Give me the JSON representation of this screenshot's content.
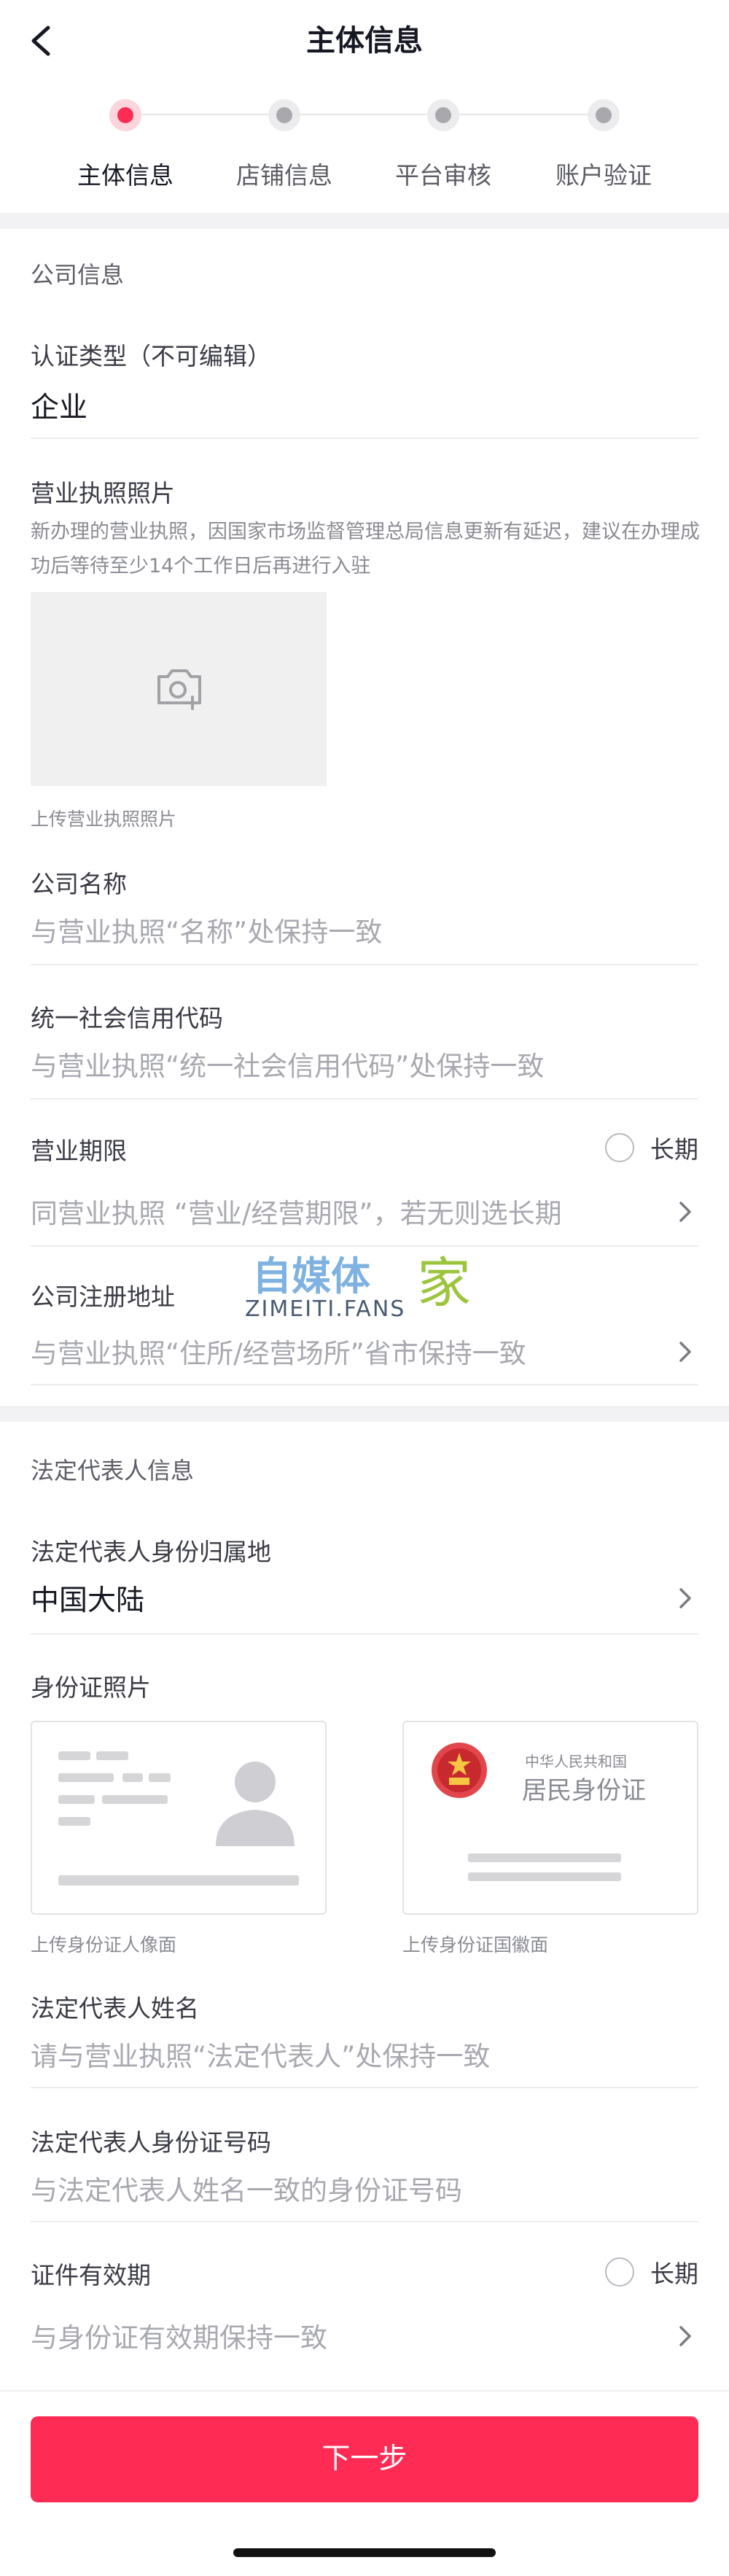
{
  "header": {
    "title": "主体信息"
  },
  "stepper": {
    "steps": [
      {
        "label": "主体信息",
        "active": true
      },
      {
        "label": "店铺信息",
        "active": false
      },
      {
        "label": "平台审核",
        "active": false
      },
      {
        "label": "账户验证",
        "active": false
      }
    ]
  },
  "company": {
    "section_title": "公司信息",
    "cert_type_label": "认证类型（不可编辑）",
    "cert_type_value": "企业",
    "license_label": "营业执照照片",
    "license_hint": "新办理的营业执照，因国家市场监督管理总局信息更新有延迟，建议在办理成功后等待至少14个工作日后再进行入驻",
    "license_caption": "上传营业执照照片",
    "name_label": "公司名称",
    "name_placeholder": "与营业执照“名称”处保持一致",
    "credit_label": "统一社会信用代码",
    "credit_placeholder": "与营业执照“统一社会信用代码”处保持一致",
    "term_label": "营业期限",
    "term_long_label": "长期",
    "term_placeholder": "同营业执照 “营业/经营期限”，若无则选长期",
    "address_label": "公司注册地址",
    "address_placeholder": "与营业执照“住所/经营场所”省市保持一致"
  },
  "legal": {
    "section_title": "法定代表人信息",
    "region_label": "法定代表人身份归属地",
    "region_value": "中国大陆",
    "id_photo_label": "身份证照片",
    "id_front_caption": "上传身份证人像面",
    "id_back_caption": "上传身份证国徽面",
    "id_card_back_line1": "中华人民共和国",
    "id_card_back_line2": "居民身份证",
    "name_label": "法定代表人姓名",
    "name_placeholder": "请与营业执照“法定代表人”处保持一致",
    "id_number_label": "法定代表人身份证号码",
    "id_number_placeholder": "与法定代表人姓名一致的身份证号码",
    "validity_label": "证件有效期",
    "validity_long_label": "长期",
    "validity_placeholder": "与身份证有效期保持一致"
  },
  "watermark": {
    "text_cn_1": "自媒体",
    "text_cn_2": "家",
    "text_en": "ZIMEITI.FANS"
  },
  "footer": {
    "next_label": "下一步"
  },
  "colors": {
    "accent": "#fe2c55",
    "text_primary": "#161823",
    "text_placeholder": "#a8a9b0",
    "gap_background": "#f2f2f4"
  }
}
